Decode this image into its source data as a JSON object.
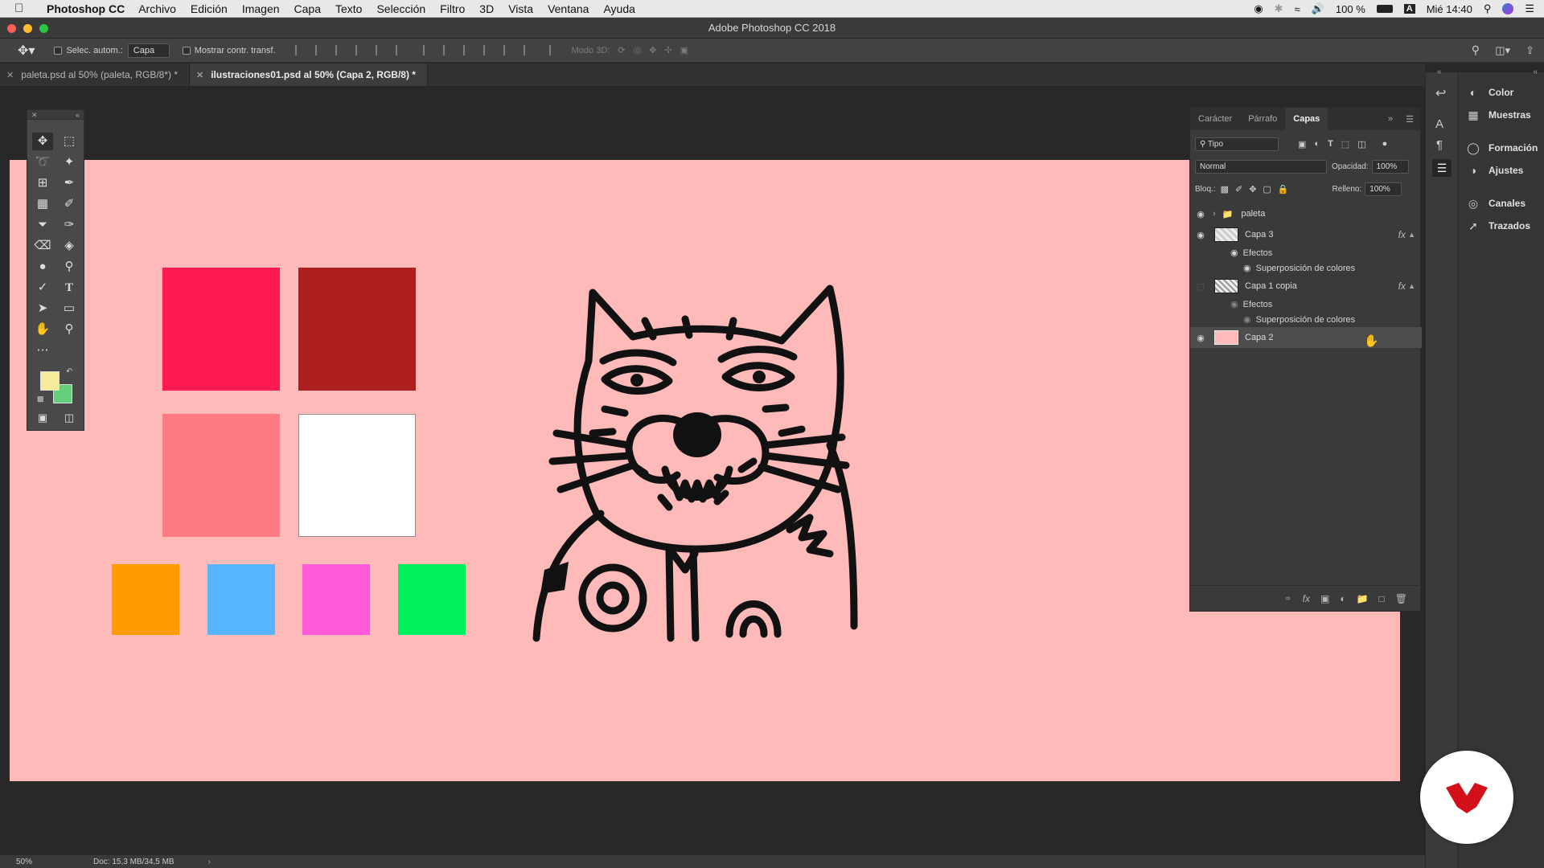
{
  "menubar": {
    "app": "Photoshop CC",
    "items": [
      "Archivo",
      "Edición",
      "Imagen",
      "Capa",
      "Texto",
      "Selección",
      "Filtro",
      "3D",
      "Vista",
      "Ventana",
      "Ayuda"
    ],
    "battery": "100 %",
    "clock": "Mié 14:40",
    "input_source": "A"
  },
  "window": {
    "title": "Adobe Photoshop CC 2018"
  },
  "options": {
    "auto_select_label": "Selec. autom.:",
    "auto_select_value": "Capa",
    "transform_label": "Mostrar contr. transf.",
    "mode3d_label": "Modo 3D:"
  },
  "tabs": [
    {
      "label": "paleta.psd al 50% (paleta, RGB/8*) *",
      "active": false
    },
    {
      "label": "ilustraciones01.psd al 50% (Capa 2, RGB/8) *",
      "active": true
    }
  ],
  "canvas": {
    "background": "#feb9b9",
    "swatches": [
      "#ff1a4f",
      "#ad1f1f",
      "#ff7a82",
      "#ffffff",
      "#ff9c00",
      "#57b6ff",
      "#ff5ad9",
      "#00f15e"
    ]
  },
  "toolbar": {
    "foreground_color": "#f6ec9a",
    "background_color": "#62d17a"
  },
  "layers_panel": {
    "tabs": [
      "Carácter",
      "Párrafo",
      "Capas"
    ],
    "active_tab": "Capas",
    "filter_value": "Tipo",
    "blend_mode": "Normal",
    "opacity_label": "Opacidad:",
    "opacity_value": "100%",
    "lock_label": "Bloq.:",
    "fill_label": "Relleno:",
    "fill_value": "100%",
    "layers": [
      {
        "name": "paleta",
        "type": "group",
        "visible": true
      },
      {
        "name": "Capa 3",
        "visible": true,
        "fx": "fx",
        "effects_label": "Efectos",
        "effect": "Superposición de colores"
      },
      {
        "name": "Capa 1 copia",
        "visible": false,
        "fx": "fx",
        "effects_label": "Efectos",
        "effect": "Superposición de colores"
      },
      {
        "name": "Capa 2",
        "visible": true,
        "selected": true
      }
    ]
  },
  "dock": {
    "items": [
      "Color",
      "Muestras",
      "Formación",
      "Ajustes",
      "Canales",
      "Trazados"
    ]
  },
  "status": {
    "zoom": "50%",
    "doc_info": "Doc: 15,3 MB/34,5 MB"
  },
  "colors": {
    "accent_logo": "#d3101a"
  }
}
